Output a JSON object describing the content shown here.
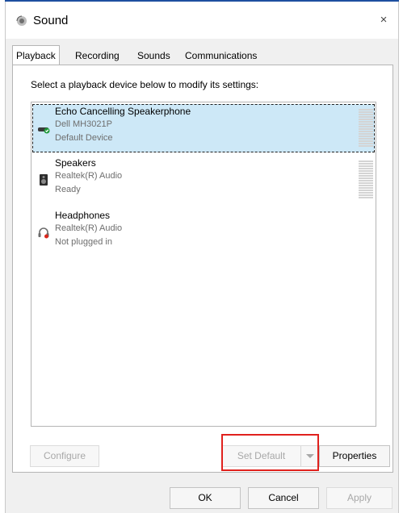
{
  "window": {
    "title": "Sound",
    "close_glyph": "×"
  },
  "tabs": [
    {
      "label": "Playback",
      "active": true
    },
    {
      "label": "Recording",
      "active": false
    },
    {
      "label": "Sounds",
      "active": false
    },
    {
      "label": "Communications",
      "active": false
    }
  ],
  "instruction": "Select a playback device below to modify its settings:",
  "devices": [
    {
      "name": "Echo Cancelling Speakerphone",
      "detail": "Dell MH3021P",
      "status": "Default Device",
      "selected": true,
      "icon": "speakerphone-icon"
    },
    {
      "name": "Speakers",
      "detail": "Realtek(R) Audio",
      "status": "Ready",
      "selected": false,
      "icon": "speaker-icon"
    },
    {
      "name": "Headphones",
      "detail": "Realtek(R) Audio",
      "status": "Not plugged in",
      "selected": false,
      "icon": "headphones-icon"
    }
  ],
  "buttons": {
    "configure": "Configure",
    "set_default": "Set Default",
    "properties": "Properties",
    "ok": "OK",
    "cancel": "Cancel",
    "apply": "Apply"
  },
  "colors": {
    "selection": "#cde8f7",
    "highlight_outline": "#e0211d",
    "title_accent": "#1d4fa0"
  }
}
